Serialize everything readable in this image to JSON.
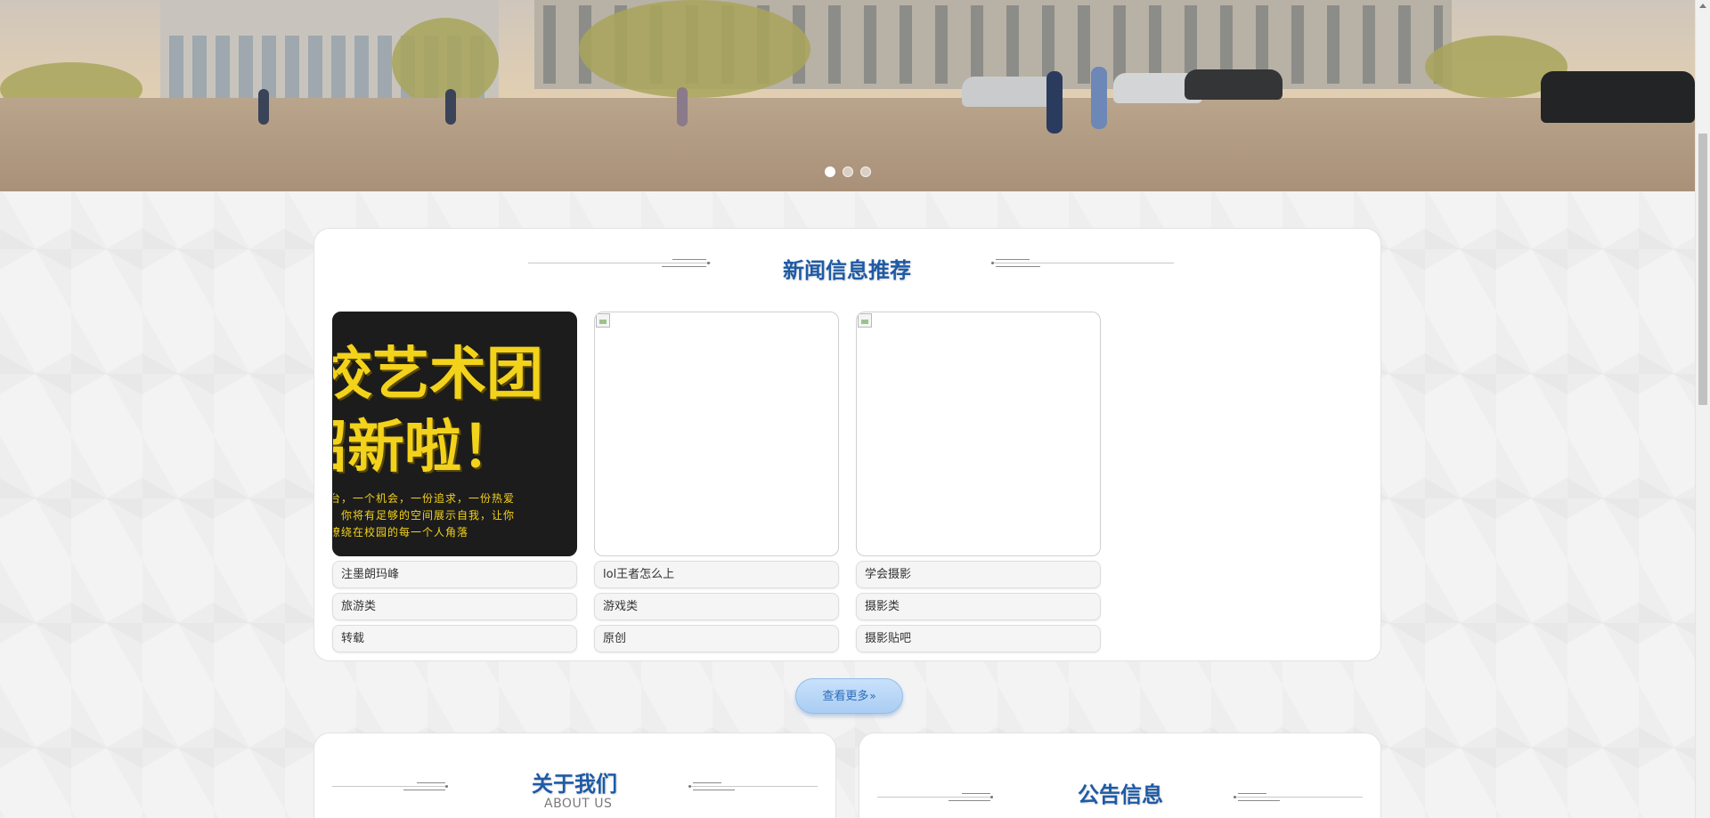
{
  "hero": {
    "slides_count": 3,
    "active_slide": 1
  },
  "news_section": {
    "title": "新闻信息推荐",
    "items": [
      {
        "image": "poster",
        "poster_lines": [
          "校艺术团",
          "招新啦！"
        ],
        "poster_small": [
          "台，一个机会，一份追求，一份热爱",
          "，你将有足够的空间展示自我，让你",
          "缭绕在校园的每一个人角落"
        ],
        "title": "注墨朗玛峰",
        "category": "旅游类",
        "source": "转载"
      },
      {
        "image": "broken",
        "title": "lol王者怎么上",
        "category": "游戏类",
        "source": "原创"
      },
      {
        "image": "broken",
        "title": "学会摄影",
        "category": "摄影类",
        "source": "摄影贴吧"
      }
    ],
    "more_label": "查看更多",
    "more_icon": "double-chevron-right-icon"
  },
  "about_section": {
    "title": "关于我们",
    "subtitle": "ABOUT US"
  },
  "notice_section": {
    "title": "公告信息"
  },
  "colors": {
    "title_blue": "#1e5aa5",
    "button_blue": "#a9cdf3",
    "page_bg": "#f3f3f4"
  }
}
